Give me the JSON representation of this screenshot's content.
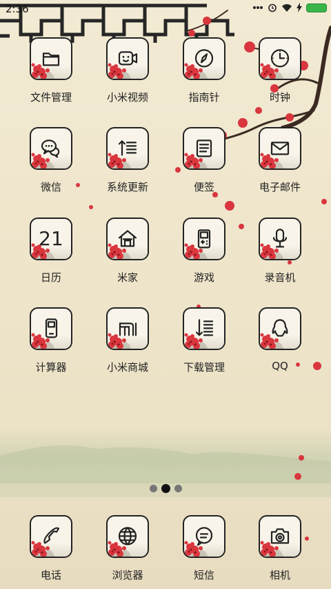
{
  "status_bar": {
    "time": "2:36",
    "icons": [
      "signal-dots-icon",
      "alarm-icon",
      "wifi-icon",
      "charging-icon",
      "battery-icon"
    ],
    "battery_color": "#39b54a"
  },
  "grid_apps": [
    {
      "label": "文件管理",
      "icon": "folder-icon"
    },
    {
      "label": "小米视频",
      "icon": "video-camera-icon"
    },
    {
      "label": "指南针",
      "icon": "compass-icon"
    },
    {
      "label": "时钟",
      "icon": "clock-icon"
    },
    {
      "label": "微信",
      "icon": "chat-bubbles-icon"
    },
    {
      "label": "系统更新",
      "icon": "update-icon"
    },
    {
      "label": "便签",
      "icon": "notes-icon"
    },
    {
      "label": "电子邮件",
      "icon": "mail-icon"
    },
    {
      "label": "日历",
      "icon": "calendar-icon",
      "glyph": "21"
    },
    {
      "label": "米家",
      "icon": "home-icon"
    },
    {
      "label": "游戏",
      "icon": "gamepad-icon"
    },
    {
      "label": "录音机",
      "icon": "microphone-icon"
    },
    {
      "label": "计算器",
      "icon": "calculator-icon"
    },
    {
      "label": "小米商城",
      "icon": "mi-store-icon"
    },
    {
      "label": "下载管理",
      "icon": "download-icon"
    },
    {
      "label": "QQ",
      "icon": "qq-penguin-icon"
    }
  ],
  "dock_apps": [
    {
      "label": "电话",
      "icon": "phone-icon"
    },
    {
      "label": "浏览器",
      "icon": "globe-icon"
    },
    {
      "label": "短信",
      "icon": "message-icon"
    },
    {
      "label": "相机",
      "icon": "camera-icon"
    }
  ],
  "page_indicator": {
    "total": 3,
    "current": 2
  },
  "colors": {
    "wallpaper": "#efe5cc",
    "blossom": "#d9363e",
    "branch": "#3b2a22",
    "lattice": "#2a2a2a",
    "mist_hills": "#c8cfb2"
  }
}
